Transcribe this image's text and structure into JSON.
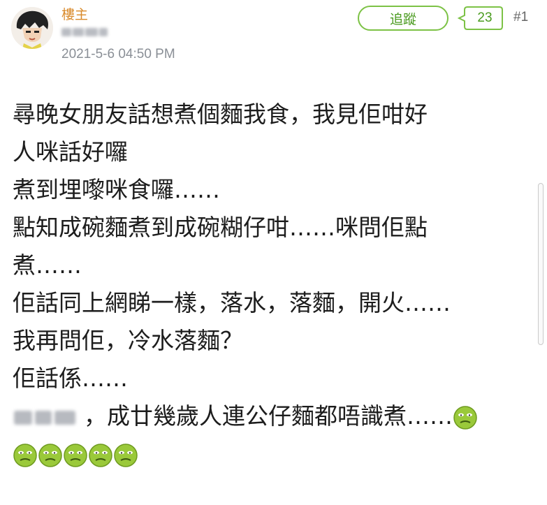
{
  "post": {
    "op_label": "樓主",
    "username": "",
    "timestamp": "2021-5-6 04:50 PM",
    "follow_label": "追蹤",
    "like_count": "23",
    "floor_number": "#1"
  },
  "content": {
    "lines": [
      "尋晚女朋友話想煮個麵我食，我見佢咁好",
      "人咪話好囉",
      "煮到埋嚟咪食囉……",
      "點知成碗麵煮到成碗糊仔咁……咪問佢點",
      "煮……",
      "佢話同上網睇一樣，落水，落麵，開火……",
      "我再問佢，冷水落麵？",
      "佢話係……",
      "，成廿幾歲人連公仔麵都唔識煮……"
    ],
    "emoji": "nauseated-face",
    "emoji_color": "#9ac93a"
  },
  "colors": {
    "accent_green": "#7cc245",
    "op_orange": "#d98a2b",
    "timestamp_gray": "#8a8f96"
  }
}
